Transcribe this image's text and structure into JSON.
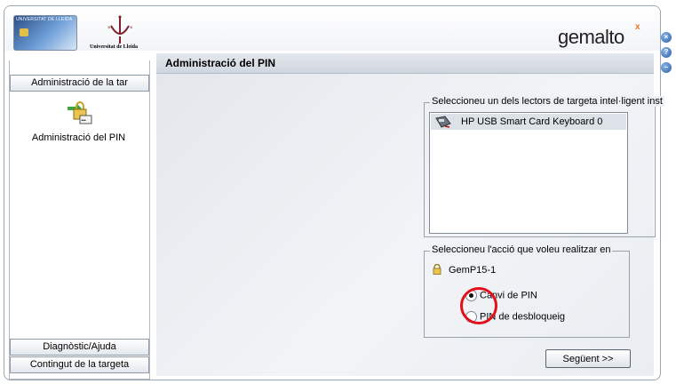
{
  "brand": {
    "university_name": "Universitat de Lleida",
    "card_caption": "UNIVERSITAT DE LLEIDA",
    "vendor": "gemalto",
    "vendor_mark": "x",
    "accent_color": "#e87722"
  },
  "sidebar": {
    "top_tab": "Administració de la tar",
    "item": {
      "label": "Administració del PIN",
      "icon": "pin-admin-icon"
    },
    "bottom_tabs": [
      "Diagnòstic/Ajuda",
      "Contingut de la targeta"
    ]
  },
  "main": {
    "title": "Administració del PIN",
    "readers_group": {
      "legend": "Seleccioneu un dels lectors de targeta intel·ligent inst",
      "items": [
        {
          "label": "HP USB Smart Card Keyboard 0",
          "icon": "card-reader-icon"
        }
      ]
    },
    "action_group": {
      "legend": "Seleccioneu l'acció que voleu realitzar en",
      "card_name": "GemP15-1",
      "options": [
        {
          "label": "Canvi de PIN",
          "checked": true
        },
        {
          "label": "PIN de desbloqueig",
          "checked": false
        }
      ]
    },
    "next_button": "Següent >>"
  },
  "window_controls": [
    {
      "name": "close-icon",
      "glyph": "×"
    },
    {
      "name": "help-icon",
      "glyph": "?"
    },
    {
      "name": "minimize-icon",
      "glyph": "–"
    }
  ]
}
